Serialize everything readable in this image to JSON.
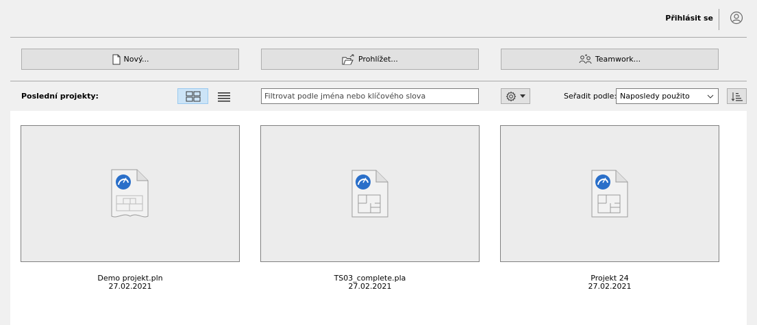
{
  "header": {
    "signin_label": "Přihlásit se",
    "user_icon": "user-circle-icon"
  },
  "actions": {
    "new_label": "Nový...",
    "browse_label": "Prohlížet...",
    "teamwork_label": "Teamwork..."
  },
  "toolbar": {
    "recent_label": "Poslední projekty:",
    "view_mode": "grid",
    "filter_placeholder": "Filtrovat podle jména nebo klíčového slova",
    "filter_value": "",
    "sort_label": "Seřadit podle:",
    "sort_value": "Naposledy použito"
  },
  "projects": [
    {
      "name": "Demo projekt.pln",
      "date": "27.02.2021",
      "icon": "solo-project-file-icon"
    },
    {
      "name": "TS03_complete.pla",
      "date": "27.02.2021",
      "icon": "archive-project-file-icon"
    },
    {
      "name": "Projekt 24",
      "date": "27.02.2021",
      "icon": "archive-project-file-icon"
    }
  ],
  "colors": {
    "accent": "#2a6fc9",
    "selected_view_bg": "#cce4f7",
    "button_bg": "#e1e1e1",
    "window_bg": "#f0f0f0"
  }
}
